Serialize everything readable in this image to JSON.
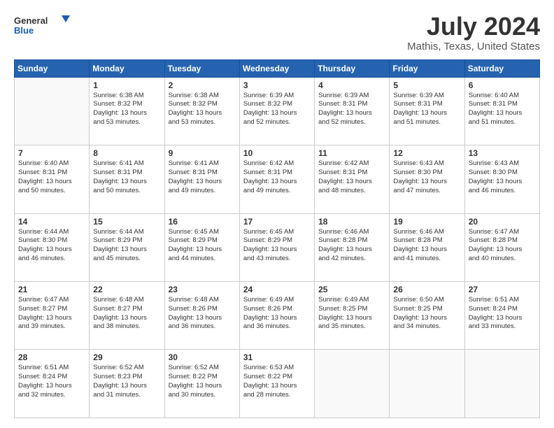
{
  "logo": {
    "line1": "General",
    "line2": "Blue"
  },
  "title": "July 2024",
  "subtitle": "Mathis, Texas, United States",
  "header_days": [
    "Sunday",
    "Monday",
    "Tuesday",
    "Wednesday",
    "Thursday",
    "Friday",
    "Saturday"
  ],
  "weeks": [
    [
      {
        "day": "",
        "text": ""
      },
      {
        "day": "1",
        "text": "Sunrise: 6:38 AM\nSunset: 8:32 PM\nDaylight: 13 hours\nand 53 minutes."
      },
      {
        "day": "2",
        "text": "Sunrise: 6:38 AM\nSunset: 8:32 PM\nDaylight: 13 hours\nand 53 minutes."
      },
      {
        "day": "3",
        "text": "Sunrise: 6:39 AM\nSunset: 8:32 PM\nDaylight: 13 hours\nand 52 minutes."
      },
      {
        "day": "4",
        "text": "Sunrise: 6:39 AM\nSunset: 8:31 PM\nDaylight: 13 hours\nand 52 minutes."
      },
      {
        "day": "5",
        "text": "Sunrise: 6:39 AM\nSunset: 8:31 PM\nDaylight: 13 hours\nand 51 minutes."
      },
      {
        "day": "6",
        "text": "Sunrise: 6:40 AM\nSunset: 8:31 PM\nDaylight: 13 hours\nand 51 minutes."
      }
    ],
    [
      {
        "day": "7",
        "text": "Sunrise: 6:40 AM\nSunset: 8:31 PM\nDaylight: 13 hours\nand 50 minutes."
      },
      {
        "day": "8",
        "text": "Sunrise: 6:41 AM\nSunset: 8:31 PM\nDaylight: 13 hours\nand 50 minutes."
      },
      {
        "day": "9",
        "text": "Sunrise: 6:41 AM\nSunset: 8:31 PM\nDaylight: 13 hours\nand 49 minutes."
      },
      {
        "day": "10",
        "text": "Sunrise: 6:42 AM\nSunset: 8:31 PM\nDaylight: 13 hours\nand 49 minutes."
      },
      {
        "day": "11",
        "text": "Sunrise: 6:42 AM\nSunset: 8:31 PM\nDaylight: 13 hours\nand 48 minutes."
      },
      {
        "day": "12",
        "text": "Sunrise: 6:43 AM\nSunset: 8:30 PM\nDaylight: 13 hours\nand 47 minutes."
      },
      {
        "day": "13",
        "text": "Sunrise: 6:43 AM\nSunset: 8:30 PM\nDaylight: 13 hours\nand 46 minutes."
      }
    ],
    [
      {
        "day": "14",
        "text": "Sunrise: 6:44 AM\nSunset: 8:30 PM\nDaylight: 13 hours\nand 46 minutes."
      },
      {
        "day": "15",
        "text": "Sunrise: 6:44 AM\nSunset: 8:29 PM\nDaylight: 13 hours\nand 45 minutes."
      },
      {
        "day": "16",
        "text": "Sunrise: 6:45 AM\nSunset: 8:29 PM\nDaylight: 13 hours\nand 44 minutes."
      },
      {
        "day": "17",
        "text": "Sunrise: 6:45 AM\nSunset: 8:29 PM\nDaylight: 13 hours\nand 43 minutes."
      },
      {
        "day": "18",
        "text": "Sunrise: 6:46 AM\nSunset: 8:28 PM\nDaylight: 13 hours\nand 42 minutes."
      },
      {
        "day": "19",
        "text": "Sunrise: 6:46 AM\nSunset: 8:28 PM\nDaylight: 13 hours\nand 41 minutes."
      },
      {
        "day": "20",
        "text": "Sunrise: 6:47 AM\nSunset: 8:28 PM\nDaylight: 13 hours\nand 40 minutes."
      }
    ],
    [
      {
        "day": "21",
        "text": "Sunrise: 6:47 AM\nSunset: 8:27 PM\nDaylight: 13 hours\nand 39 minutes."
      },
      {
        "day": "22",
        "text": "Sunrise: 6:48 AM\nSunset: 8:27 PM\nDaylight: 13 hours\nand 38 minutes."
      },
      {
        "day": "23",
        "text": "Sunrise: 6:48 AM\nSunset: 8:26 PM\nDaylight: 13 hours\nand 36 minutes."
      },
      {
        "day": "24",
        "text": "Sunrise: 6:49 AM\nSunset: 8:26 PM\nDaylight: 13 hours\nand 36 minutes."
      },
      {
        "day": "25",
        "text": "Sunrise: 6:49 AM\nSunset: 8:25 PM\nDaylight: 13 hours\nand 35 minutes."
      },
      {
        "day": "26",
        "text": "Sunrise: 6:50 AM\nSunset: 8:25 PM\nDaylight: 13 hours\nand 34 minutes."
      },
      {
        "day": "27",
        "text": "Sunrise: 6:51 AM\nSunset: 8:24 PM\nDaylight: 13 hours\nand 33 minutes."
      }
    ],
    [
      {
        "day": "28",
        "text": "Sunrise: 6:51 AM\nSunset: 8:24 PM\nDaylight: 13 hours\nand 32 minutes."
      },
      {
        "day": "29",
        "text": "Sunrise: 6:52 AM\nSunset: 8:23 PM\nDaylight: 13 hours\nand 31 minutes."
      },
      {
        "day": "30",
        "text": "Sunrise: 6:52 AM\nSunset: 8:22 PM\nDaylight: 13 hours\nand 30 minutes."
      },
      {
        "day": "31",
        "text": "Sunrise: 6:53 AM\nSunset: 8:22 PM\nDaylight: 13 hours\nand 28 minutes."
      },
      {
        "day": "",
        "text": ""
      },
      {
        "day": "",
        "text": ""
      },
      {
        "day": "",
        "text": ""
      }
    ]
  ]
}
